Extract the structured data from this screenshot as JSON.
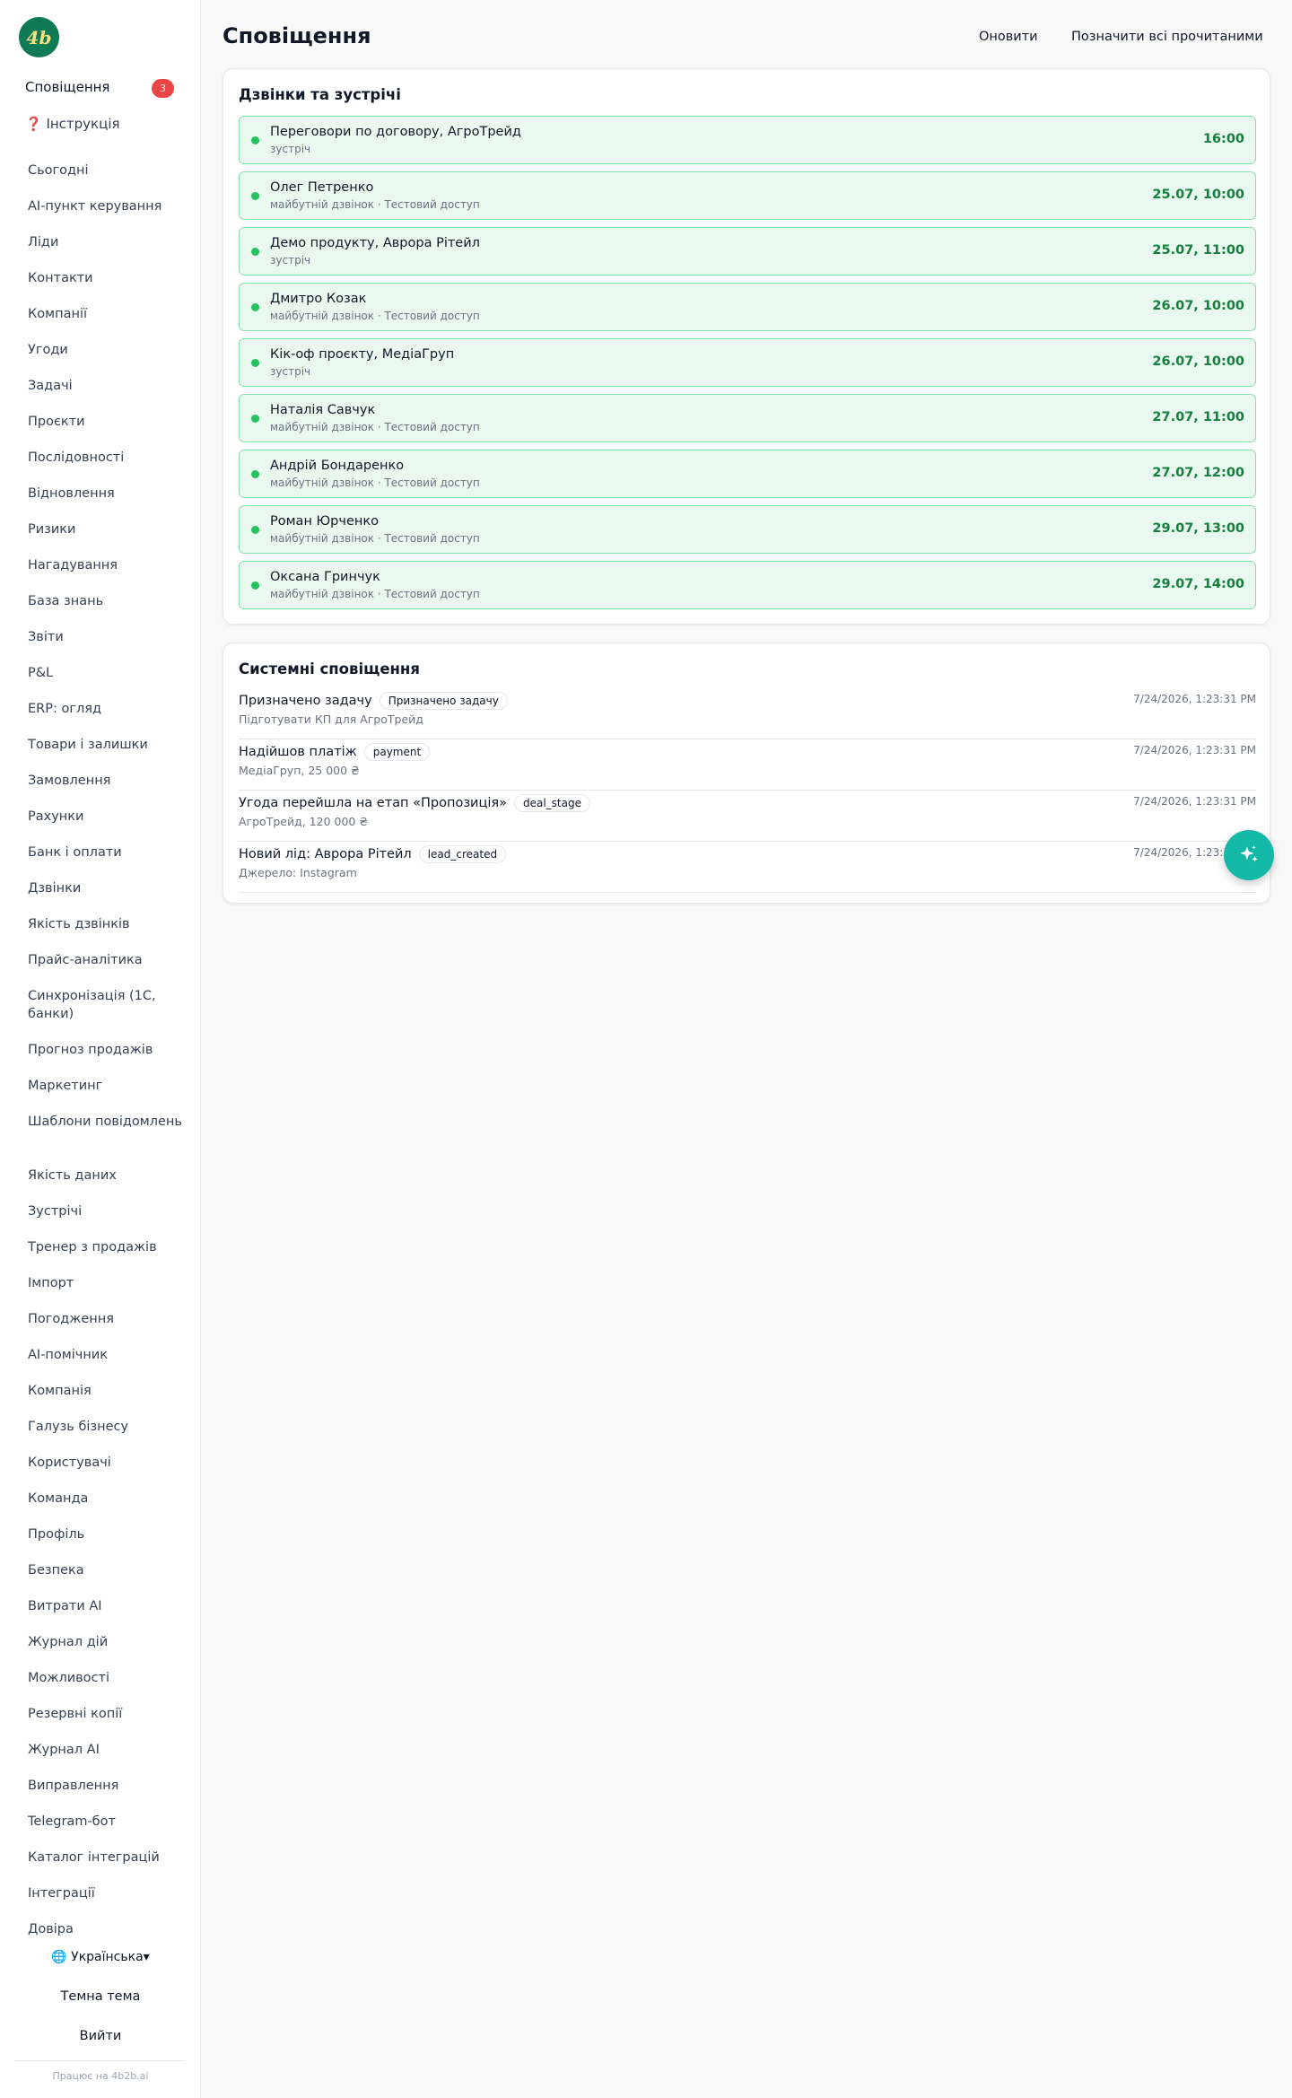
{
  "brand": {
    "logo_text": "4b"
  },
  "sidebar": {
    "notifications_label": "Сповіщення",
    "notifications_count": "3",
    "help_label": "❓ Інструкція",
    "items": [
      "Сьогодні",
      "AI-пункт керування",
      "Ліди",
      "Контакти",
      "Компанії",
      "Угоди",
      "Задачі",
      "Проєкти",
      "Послідовності",
      "Відновлення",
      "Ризики",
      "Нагадування",
      "База знань",
      "Звіти",
      "P&L",
      "ERP: огляд",
      "Товари і залишки",
      "Замовлення",
      "Рахунки",
      "Банк і оплати",
      "Дзвінки",
      "Якість дзвінків",
      "Прайс-аналітика",
      "Синхронізація (1С, банки)",
      "Прогноз продажів",
      "Маркетинг",
      "Шаблони повідомлень",
      "Якість даних",
      "Зустрічі",
      "Тренер з продажів",
      "Імпорт",
      "Погодження",
      "AI-помічник",
      "Компанія",
      "Галузь бізнесу",
      "Користувачі",
      "Команда",
      "Профіль",
      "Безпека",
      "Витрати AI",
      "Журнал дій",
      "Можливості",
      "Резервні копії",
      "Журнал AI",
      "Виправлення",
      "Telegram-бот",
      "Каталог інтеграцій",
      "Інтеграції",
      "Довіра"
    ],
    "language": "🌐 Українська▾",
    "theme_label": "Темна тема",
    "logout_label": "Вийти",
    "powered_by": "Працює на 4b2b.ai"
  },
  "header": {
    "title": "Сповіщення",
    "refresh_label": "Оновити",
    "mark_all_label": "Позначити всі прочитаними"
  },
  "calls": {
    "title": "Дзвінки та зустрічі",
    "items": [
      {
        "title": "Переговори по договору, АгроТрейд",
        "sub": "зустріч",
        "time": "16:00"
      },
      {
        "title": "Олег Петренко",
        "sub": "майбутній дзвінок · Тестовий доступ",
        "time": "25.07, 10:00"
      },
      {
        "title": "Демо продукту, Аврора Рітейл",
        "sub": "зустріч",
        "time": "25.07, 11:00"
      },
      {
        "title": "Дмитро Козак",
        "sub": "майбутній дзвінок · Тестовий доступ",
        "time": "26.07, 10:00"
      },
      {
        "title": "Кік-оф проєкту, МедіаГруп",
        "sub": "зустріч",
        "time": "26.07, 10:00"
      },
      {
        "title": "Наталія Савчук",
        "sub": "майбутній дзвінок · Тестовий доступ",
        "time": "27.07, 11:00"
      },
      {
        "title": "Андрій Бондаренко",
        "sub": "майбутній дзвінок · Тестовий доступ",
        "time": "27.07, 12:00"
      },
      {
        "title": "Роман Юрченко",
        "sub": "майбутній дзвінок · Тестовий доступ",
        "time": "29.07, 13:00"
      },
      {
        "title": "Оксана Гринчук",
        "sub": "майбутній дзвінок · Тестовий доступ",
        "time": "29.07, 14:00"
      }
    ]
  },
  "system": {
    "title": "Системні сповіщення",
    "items": [
      {
        "title": "Призначено задачу",
        "tag": "Призначено задачу",
        "sub": "Підготувати КП для АгроТрейд",
        "time": "7/24/2026, 1:23:31 PM"
      },
      {
        "title": "Надійшов платіж",
        "tag": "payment",
        "sub": "МедіаГруп, 25 000 ₴",
        "time": "7/24/2026, 1:23:31 PM"
      },
      {
        "title": "Угода перейшла на етап «Пропозиція»",
        "tag": "deal_stage",
        "sub": "АгроТрейд, 120 000 ₴",
        "time": "7/24/2026, 1:23:31 PM"
      },
      {
        "title": "Новий лід: Аврора Рітейл",
        "tag": "lead_created",
        "sub": "Джерело: Instagram",
        "time": "7/24/2026, 1:23:31 PM"
      }
    ]
  },
  "fab": {
    "icon": "sparkles-icon"
  },
  "colors": {
    "brand": "#0f7a55",
    "accent": "#14b8a6",
    "call_bg": "#e9f9ef",
    "call_time": "#15803d",
    "badge": "#ef4444"
  }
}
